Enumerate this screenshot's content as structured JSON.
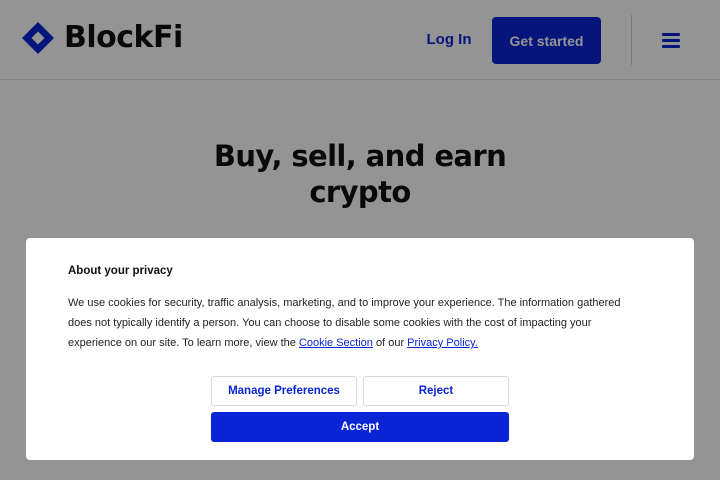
{
  "colors": {
    "brand_blue": "#0a25d6",
    "text_dark": "#111111",
    "overlay": "rgba(0,0,0,0.42)",
    "dialog_bg": "#ffffff"
  },
  "header": {
    "logo_text": "BlockFi",
    "logo_icon": "blockfi-diamond-logo",
    "login_label": "Log In",
    "get_started_label": "Get started",
    "menu_icon": "hamburger-menu-icon"
  },
  "hero": {
    "title_line1": "Buy, sell, and earn",
    "title_line2": "crypto"
  },
  "cookie_dialog": {
    "title": "About your privacy",
    "body_text": "We use cookies for security, traffic analysis, marketing, and to improve your experience. The information gathered does not typically identify a person. You can choose to disable some cookies with the cost of impacting your experience on our site. To learn more, view the ",
    "cookie_section_link": "Cookie Section",
    "connector_text": " of our ",
    "privacy_policy_link": "Privacy Policy.",
    "manage_label": "Manage Preferences",
    "reject_label": "Reject",
    "accept_label": "Accept"
  }
}
